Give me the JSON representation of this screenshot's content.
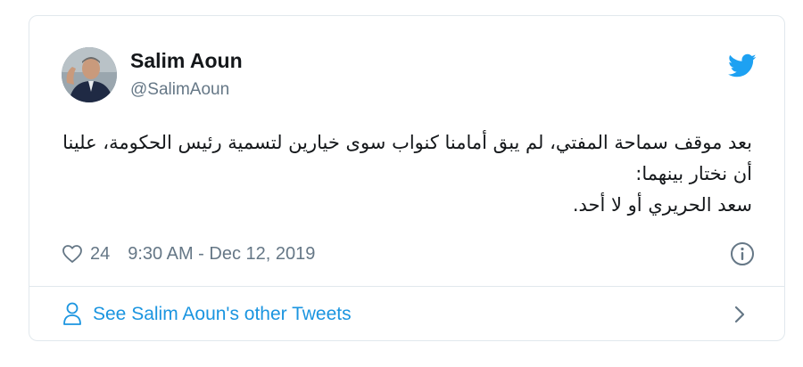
{
  "tweet": {
    "author_name": "Salim Aoun",
    "author_handle": "@SalimAoun",
    "text_lines": [
      "بعد موقف سماحة المفتي، لم يبق أمامنا كنواب سوى خيارين لتسمية رئيس الحكومة، علينا",
      "أن نختار بينهما:",
      "سعد الحريري أو لا أحد."
    ],
    "like_count": "24",
    "timestamp": "9:30 AM - Dec 12, 2019"
  },
  "footer": {
    "see_more_label": "See Salim Aoun's other Tweets"
  },
  "icons": {
    "brand": "twitter-bird-icon",
    "like": "heart-icon",
    "info": "info-icon",
    "profile": "person-icon",
    "chevron": "chevron-right-icon"
  },
  "colors": {
    "twitter_blue": "#1da1f2",
    "link_blue": "#1b95e0",
    "secondary_text": "#657786",
    "primary_text": "#14171a",
    "border": "#e1e8ed"
  }
}
